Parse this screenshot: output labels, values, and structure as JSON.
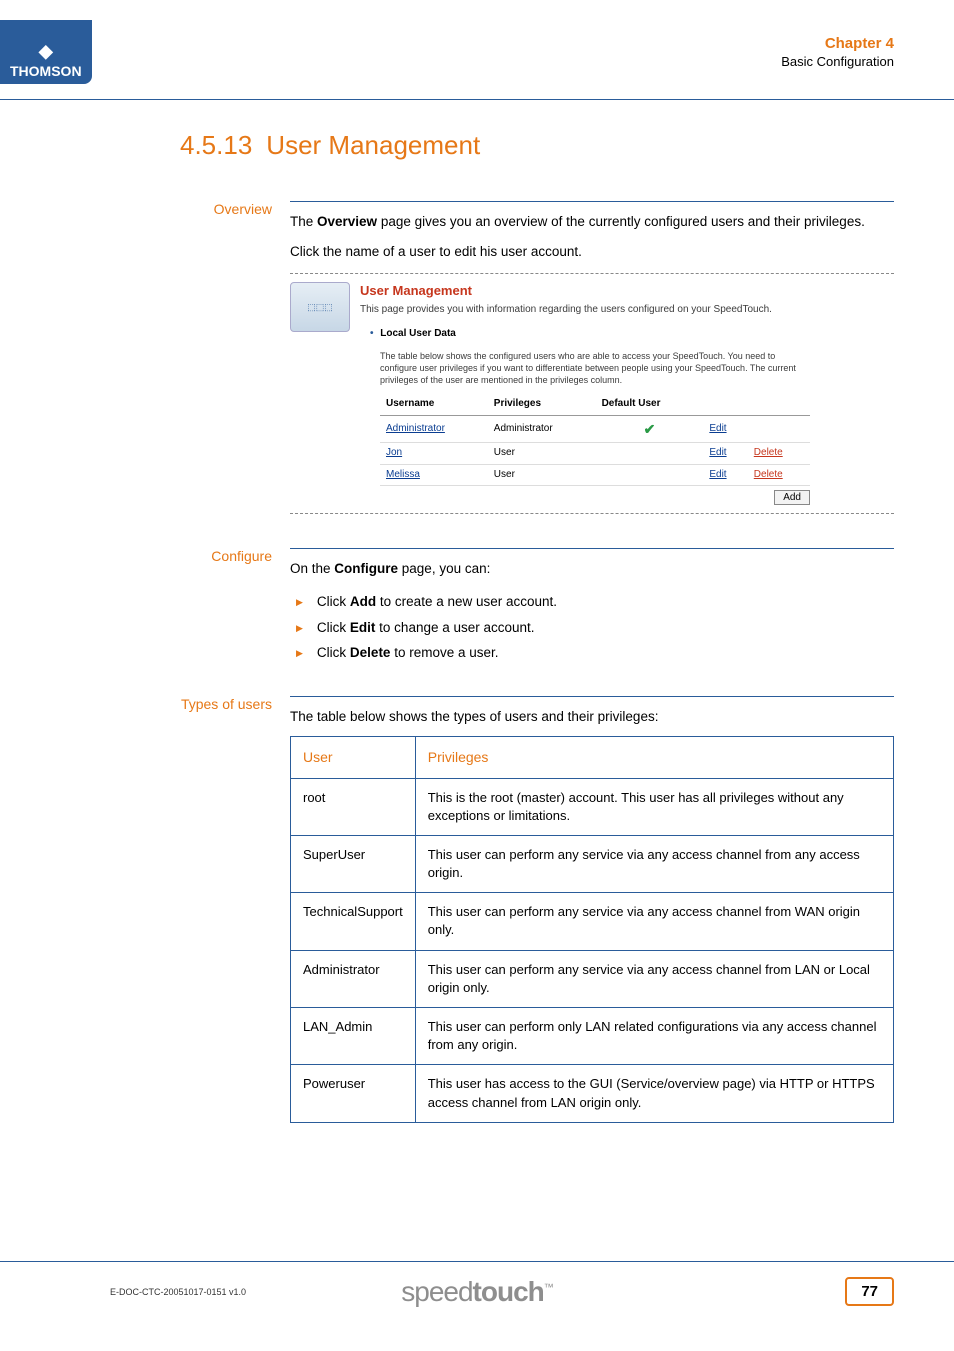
{
  "header": {
    "brand": "THOMSON",
    "chapter": "Chapter 4",
    "subtitle": "Basic Configuration"
  },
  "title": {
    "number": "4.5.13",
    "text": "User Management"
  },
  "overview": {
    "label": "Overview",
    "p1a": "The ",
    "p1b": "Overview",
    "p1c": " page gives you an overview of the currently configured users and their privileges.",
    "p2": "Click the name of a user to edit his user account.",
    "um_title": "User Management",
    "um_desc": "This page provides you with information regarding the users configured on your SpeedTouch.",
    "um_sub": "Local User Data",
    "um_note": "The table below shows the configured users who are able to access your SpeedTouch. You need to configure user privileges if you want to differentiate between people using your SpeedTouch. The current privileges of the user are mentioned in the privileges column.",
    "cols": {
      "c1": "Username",
      "c2": "Privileges",
      "c3": "Default User"
    },
    "rows": [
      {
        "user": "Administrator",
        "priv": "Administrator",
        "def": true,
        "edit": "Edit",
        "del": ""
      },
      {
        "user": "Jon",
        "priv": "User",
        "def": false,
        "edit": "Edit",
        "del": "Delete"
      },
      {
        "user": "Melissa",
        "priv": "User",
        "def": false,
        "edit": "Edit",
        "del": "Delete"
      }
    ],
    "add": "Add"
  },
  "configure": {
    "label": "Configure",
    "intro_a": "On the ",
    "intro_b": "Configure",
    "intro_c": " page, you can:",
    "b1a": "Click ",
    "b1b": "Add",
    "b1c": " to create a new user account.",
    "b2a": "Click ",
    "b2b": "Edit",
    "b2c": " to change a user account.",
    "b3a": "Click ",
    "b3b": "Delete",
    "b3c": " to remove a user."
  },
  "types": {
    "label": "Types of users",
    "intro": "The table below shows the types of users and their privileges:",
    "h1": "User",
    "h2": "Privileges",
    "rows": [
      {
        "u": "root",
        "p": "This is the root (master) account. This user has all privileges without any exceptions or limitations."
      },
      {
        "u": "SuperUser",
        "p": "This user can perform any service via any access channel from any access origin."
      },
      {
        "u": "TechnicalSupport",
        "p": "This user can perform any service via any access channel from WAN origin only."
      },
      {
        "u": "Administrator",
        "p": "This user can perform any service via any access channel from LAN or Local origin only."
      },
      {
        "u": "LAN_Admin",
        "p": "This user can perform only LAN related configurations via any access channel from any origin."
      },
      {
        "u": "Poweruser",
        "p": "This user has access to the GUI (Service/overview page) via HTTP or HTTPS access channel from LAN origin only."
      }
    ]
  },
  "footer": {
    "docid": "E-DOC-CTC-20051017-0151 v1.0",
    "brand_a": "speed",
    "brand_b": "touch",
    "tm": "™",
    "page": "77"
  }
}
